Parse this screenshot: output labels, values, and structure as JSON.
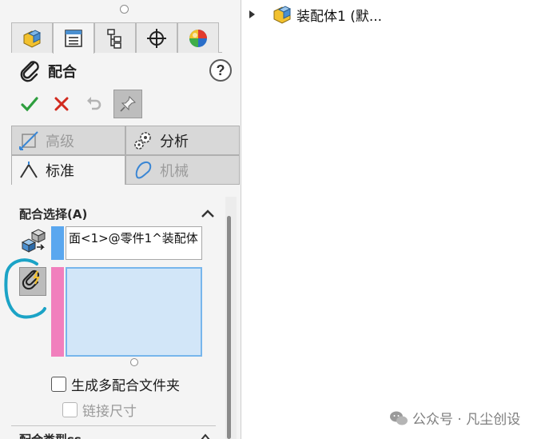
{
  "property_manager": {
    "title": "配合",
    "help_label": "?",
    "tabs": [
      {
        "icon": "feature-manager-icon"
      },
      {
        "icon": "property-manager-icon"
      },
      {
        "icon": "configuration-manager-icon"
      },
      {
        "icon": "dimxpert-icon"
      },
      {
        "icon": "display-manager-icon"
      }
    ],
    "mode_tabs": {
      "advanced": "高级",
      "analysis": "分析",
      "standard": "标准",
      "mechanical": "机械"
    },
    "mate_selection": {
      "header": "配合选择(A)",
      "selected_entity": "面<1>@零件1^装配体",
      "selection_bar_color": "#5aa7ef",
      "list_bar_color": "#f17fbd"
    },
    "checkboxes": {
      "multi_mate_folder": "生成多配合文件夹",
      "link_dimensions": "链接尺寸"
    },
    "next_group_header": "配合类型ss"
  },
  "tree": {
    "root_label": "装配体1 (默..."
  },
  "watermark": {
    "text": "公众号 · 凡尘创设"
  },
  "colors": {
    "accept_green": "#2e9e3e",
    "cancel_red": "#d22a1e",
    "annotation_teal": "#1ba3c6"
  }
}
